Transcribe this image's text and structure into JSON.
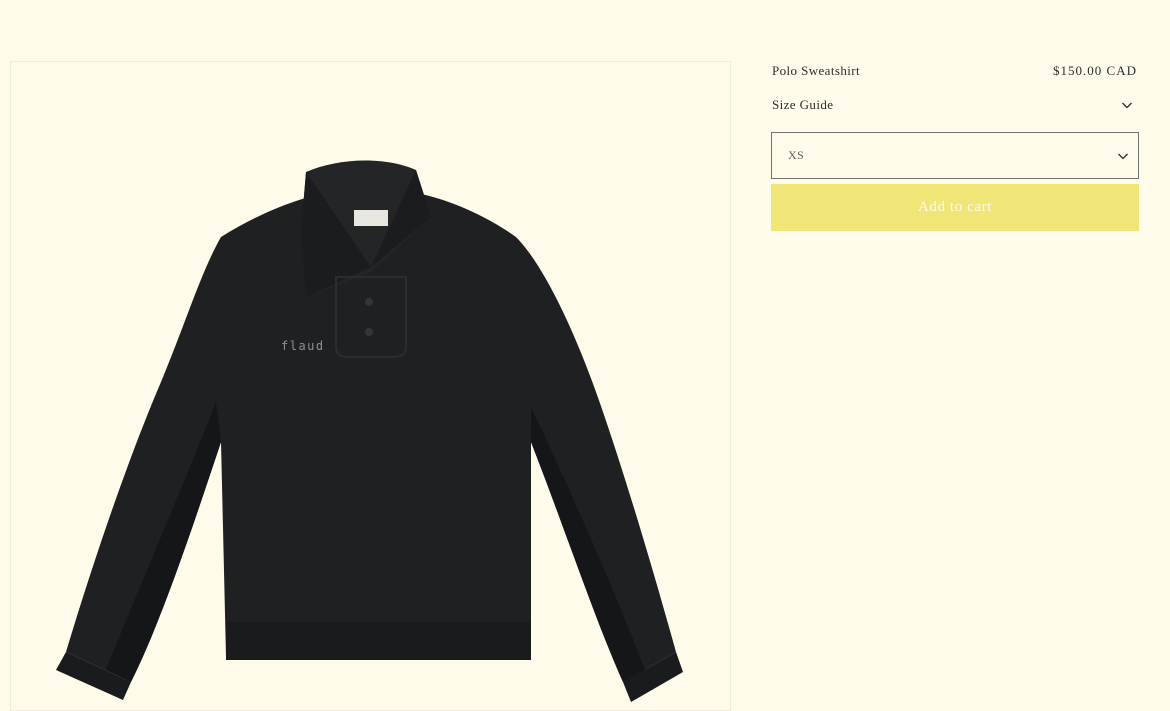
{
  "product": {
    "title": "Polo Sweatshirt",
    "price": "$150.00 CAD",
    "image_alt": "Black polo sweatshirt with embroidered logo",
    "logo_text": "flaud"
  },
  "size_guide": {
    "label": "Size Guide",
    "icon": "chevron-down-icon"
  },
  "size_select": {
    "value": "XS",
    "icon": "chevron-down-icon"
  },
  "cart": {
    "add_label": "Add to cart"
  },
  "colors": {
    "background": "#fefbeb",
    "button": "#f0e577",
    "garment": "#1e2021"
  }
}
